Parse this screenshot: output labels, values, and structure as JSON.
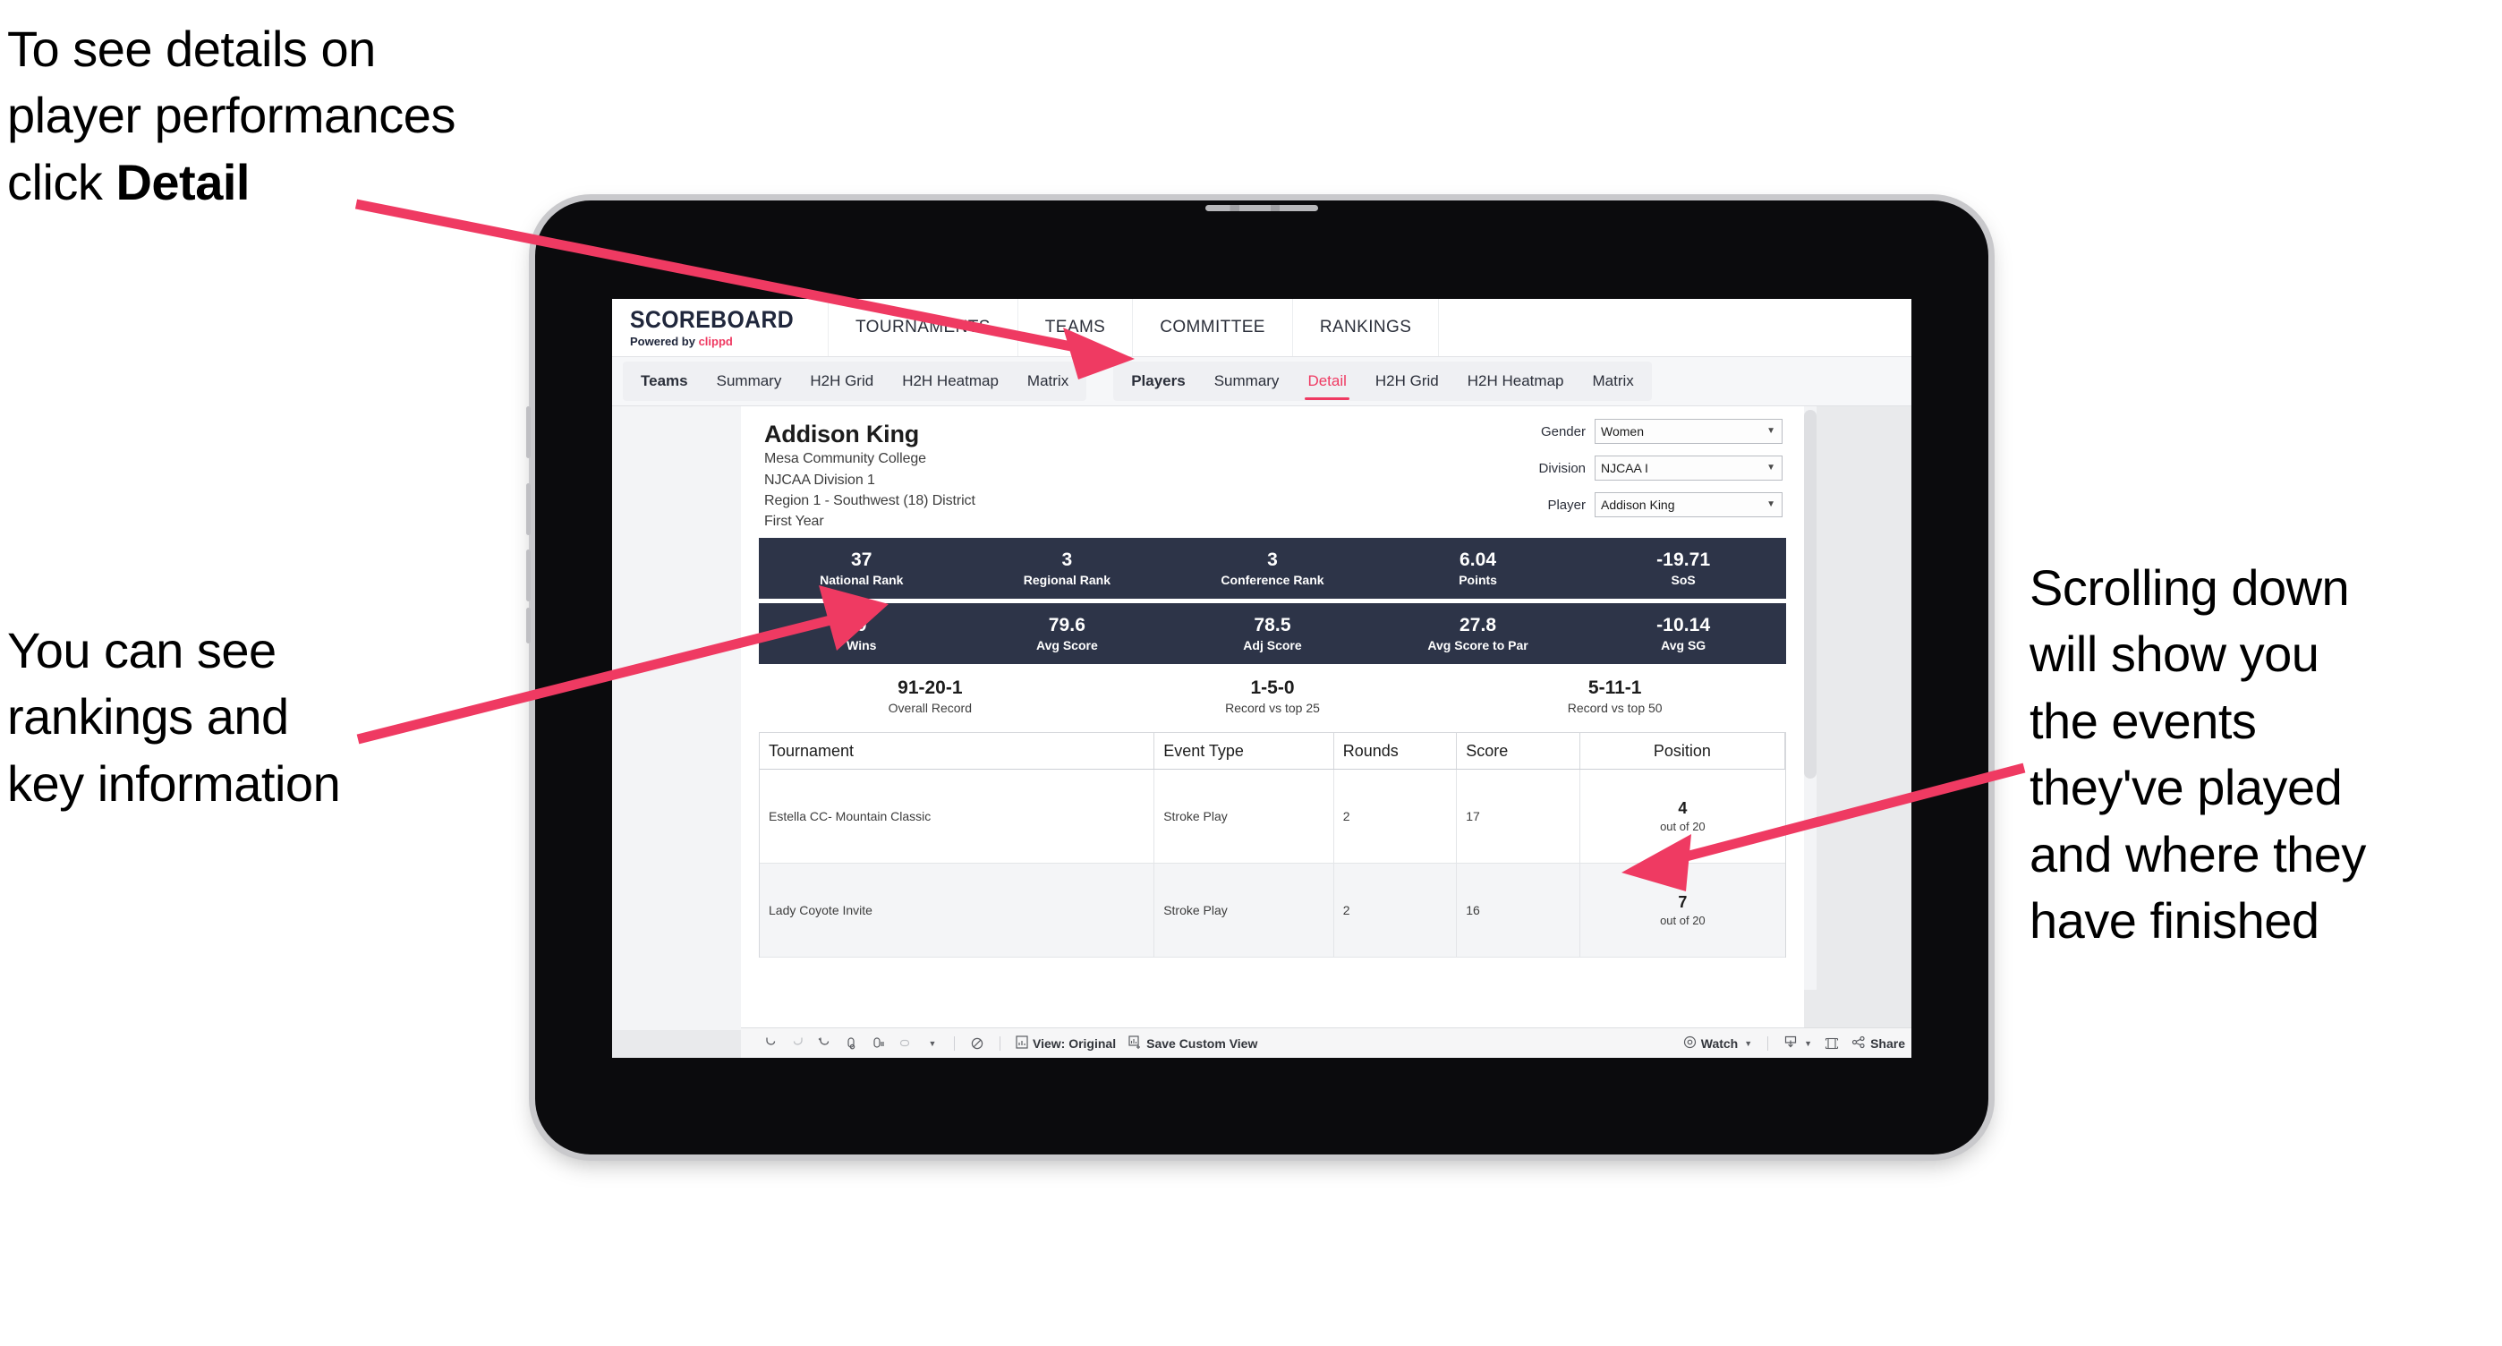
{
  "annotations": {
    "top_left": "To see details on\nplayer performances\nclick ",
    "top_left_bold": "Detail",
    "mid_left": "You can see\nrankings and\nkey information",
    "right": "Scrolling down\nwill show you\nthe events\nthey've played\nand where they\nhave finished",
    "arrow_color": "#ef3a62"
  },
  "app": {
    "logo": {
      "word": "SCOREBOARD",
      "powered_prefix": "Powered by ",
      "brand": "clippd"
    },
    "main_nav": [
      "TOURNAMENTS",
      "TEAMS",
      "COMMITTEE",
      "RANKINGS"
    ],
    "tab_groups": [
      {
        "head": "Teams",
        "tabs": [
          "Summary",
          "H2H Grid",
          "H2H Heatmap",
          "Matrix"
        ],
        "active": null
      },
      {
        "head": "Players",
        "tabs": [
          "Summary",
          "Detail",
          "H2H Grid",
          "H2H Heatmap",
          "Matrix"
        ],
        "active": "Detail"
      }
    ]
  },
  "player": {
    "name": "Addison King",
    "meta": [
      "Mesa Community College",
      "NJCAA Division 1",
      "Region 1 - Southwest (18) District",
      "First Year"
    ]
  },
  "filters": [
    {
      "label": "Gender",
      "value": "Women"
    },
    {
      "label": "Division",
      "value": "NJCAA I"
    },
    {
      "label": "Player",
      "value": "Addison King"
    }
  ],
  "stats_row1": [
    {
      "value": "37",
      "label": "National Rank"
    },
    {
      "value": "3",
      "label": "Regional Rank"
    },
    {
      "value": "3",
      "label": "Conference Rank"
    },
    {
      "value": "6.04",
      "label": "Points"
    },
    {
      "value": "-19.71",
      "label": "SoS"
    }
  ],
  "stats_row2": [
    {
      "value": "0",
      "label": "Wins"
    },
    {
      "value": "79.6",
      "label": "Avg Score"
    },
    {
      "value": "78.5",
      "label": "Adj Score"
    },
    {
      "value": "27.8",
      "label": "Avg Score to Par"
    },
    {
      "value": "-10.14",
      "label": "Avg SG"
    }
  ],
  "records": [
    {
      "value": "91-20-1",
      "label": "Overall Record"
    },
    {
      "value": "1-5-0",
      "label": "Record vs top 25"
    },
    {
      "value": "5-11-1",
      "label": "Record vs top 50"
    }
  ],
  "events_table": {
    "columns": [
      "Tournament",
      "Event Type",
      "Rounds",
      "Score",
      "Position"
    ],
    "rows": [
      {
        "tournament": "Estella CC- Mountain Classic",
        "event_type": "Stroke Play",
        "rounds": "2",
        "score": "17",
        "position": "4",
        "position_sub": "out of 20"
      },
      {
        "tournament": "Lady Coyote Invite",
        "event_type": "Stroke Play",
        "rounds": "2",
        "score": "16",
        "position": "7",
        "position_sub": "out of 20"
      }
    ]
  },
  "toolbar": {
    "view_label": "View: Original",
    "save_label": "Save Custom View",
    "watch_label": "Watch",
    "share_label": "Share"
  },
  "colors": {
    "accent_pink": "#ef3a62",
    "stat_band": "#2d3448",
    "app_bg": "#e9eaec"
  }
}
